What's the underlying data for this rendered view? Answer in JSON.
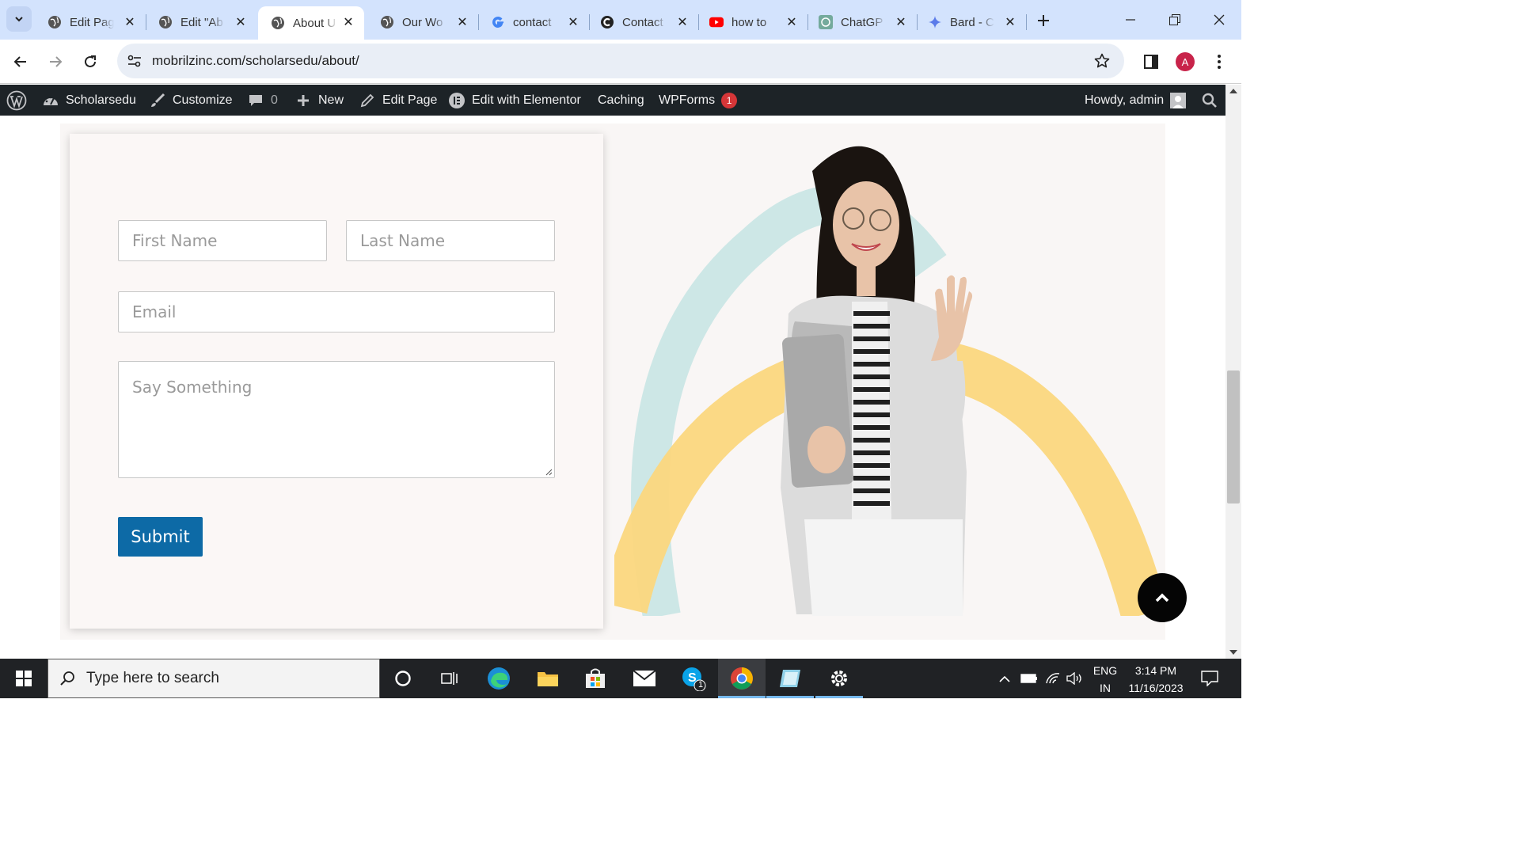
{
  "browser": {
    "tabs": [
      {
        "title": "Edit Pag",
        "icon": "globe-icon",
        "active": false
      },
      {
        "title": "Edit \"Ab",
        "icon": "globe-icon",
        "active": false
      },
      {
        "title": "About U",
        "icon": "globe-icon",
        "active": true
      },
      {
        "title": "Our Wo",
        "icon": "globe-icon",
        "active": false
      },
      {
        "title": "contact",
        "icon": "google-icon",
        "active": false
      },
      {
        "title": "Contact",
        "icon": "c-logo-icon",
        "active": false
      },
      {
        "title": "how to",
        "icon": "youtube-icon",
        "active": false
      },
      {
        "title": "ChatGP",
        "icon": "chatgpt-icon",
        "active": false
      },
      {
        "title": "Bard - C",
        "icon": "bard-icon",
        "active": false
      }
    ],
    "url": "mobrilzinc.com/scholarsedu/about/",
    "profile_initial": "A"
  },
  "wp_admin_bar": {
    "site_name": "Scholarsedu",
    "customize": "Customize",
    "comments_count": "0",
    "new": "New",
    "edit_page": "Edit Page",
    "edit_elementor": "Edit with Elementor",
    "caching": "Caching",
    "wpforms": "WPForms",
    "wpforms_badge": "1",
    "howdy": "Howdy, admin"
  },
  "form": {
    "first_name_placeholder": "First Name",
    "last_name_placeholder": "Last Name",
    "email_placeholder": "Email",
    "message_placeholder": "Say Something",
    "submit_label": "Submit"
  },
  "colors": {
    "submit_bg": "#0d6aa6",
    "arc_teal": "#cde7e6",
    "arc_yellow": "#fbd77e",
    "admin_bar": "#1d2327"
  },
  "taskbar": {
    "search_placeholder": "Type here to search",
    "lang_top": "ENG",
    "lang_bottom": "IN",
    "time": "3:14 PM",
    "date": "11/16/2023",
    "skype_badge": "1"
  }
}
